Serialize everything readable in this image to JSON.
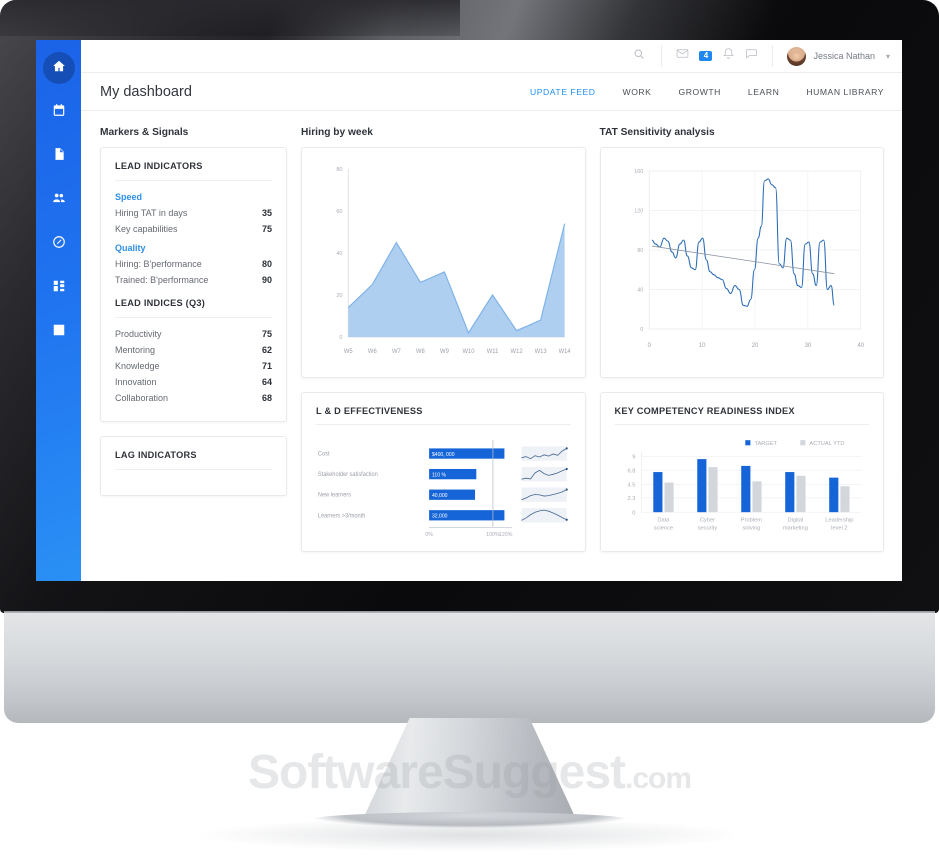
{
  "brand": {
    "watermark": "SoftwareSuggest",
    "watermark_tld": ".com"
  },
  "colors": {
    "accent": "#1e90f5",
    "sidebar_from": "#1b63e8",
    "sidebar_to": "#2a90f5",
    "bar_blue": "#1565d8",
    "bar_grey": "#d3d7dc",
    "area_fill": "#a8cbf0"
  },
  "sidebar": {
    "items": [
      {
        "name": "home",
        "icon": "home-icon",
        "active": true
      },
      {
        "name": "calendar",
        "icon": "calendar-icon",
        "active": false
      },
      {
        "name": "documents",
        "icon": "document-icon",
        "active": false
      },
      {
        "name": "people",
        "icon": "users-icon",
        "active": false
      },
      {
        "name": "links",
        "icon": "link-icon",
        "active": false
      },
      {
        "name": "apps",
        "icon": "grid-icon",
        "active": false
      },
      {
        "name": "reports",
        "icon": "chart-icon",
        "active": false
      }
    ]
  },
  "topbar": {
    "search_icon": "search-icon",
    "mail_icon": "envelope-icon",
    "notification_count": "4",
    "bell_icon": "bell-icon",
    "chat_icon": "chat-icon",
    "user_name": "Jessica Nathan",
    "caret_icon": "chevron-down-icon"
  },
  "header": {
    "title": "My dashboard",
    "tabs": [
      {
        "label": "UPDATE FEED",
        "active": true
      },
      {
        "label": "WORK",
        "active": false
      },
      {
        "label": "GROWTH",
        "active": false
      },
      {
        "label": "LEARN",
        "active": false
      },
      {
        "label": "HUMAN LIBRARY",
        "active": false
      }
    ]
  },
  "sections": {
    "markers": "Markers & Signals",
    "hiring": "Hiring by week",
    "tat": "TAT Sensitivity analysis"
  },
  "lead_indicators": {
    "title": "LEAD INDICATORS",
    "groups": [
      {
        "title": "Speed",
        "rows": [
          {
            "label": "Hiring TAT in days",
            "value": "35"
          },
          {
            "label": "Key capabilities",
            "value": "75"
          }
        ]
      },
      {
        "title": "Quality",
        "rows": [
          {
            "label": "Hiring: B'performance",
            "value": "80"
          },
          {
            "label": "Trained: B'performance",
            "value": "90"
          }
        ]
      }
    ]
  },
  "lead_indices": {
    "title": "LEAD INDICES (Q3)",
    "rows": [
      {
        "label": "Productivity",
        "value": "75"
      },
      {
        "label": "Mentoring",
        "value": "62"
      },
      {
        "label": "Knowledge",
        "value": "71"
      },
      {
        "label": "Innovation",
        "value": "64"
      },
      {
        "label": "Collaboration",
        "value": "68"
      }
    ]
  },
  "lag_indicators": {
    "title": "LAG INDICATORS"
  },
  "ld_effectiveness": {
    "title": "L & D EFFECTIVENESS"
  },
  "competency": {
    "title": "KEY COMPETENCY READINESS INDEX"
  },
  "chart_data": [
    {
      "id": "hiring_by_week",
      "type": "area",
      "title": "Hiring by week",
      "categories": [
        "W5",
        "W6",
        "W7",
        "W8",
        "W9",
        "W10",
        "W11",
        "W12",
        "W13",
        "W14"
      ],
      "values": [
        14,
        25,
        45,
        26,
        31,
        2,
        20,
        3,
        8,
        54
      ],
      "xlabel": "",
      "ylabel": "",
      "ylim": [
        0,
        80
      ],
      "yticks": [
        0,
        20,
        40,
        60,
        80
      ],
      "grid": false,
      "fill_color": "#a8cbf0",
      "line_color": "#7eb2e8"
    },
    {
      "id": "tat_sensitivity",
      "type": "line",
      "title": "TAT Sensitivity analysis",
      "xlim": [
        0,
        40
      ],
      "ylim": [
        0,
        160
      ],
      "xticks": [
        0,
        10,
        20,
        30,
        40
      ],
      "yticks": [
        0,
        40,
        80,
        120,
        160
      ],
      "grid": true,
      "legend": "none",
      "series": [
        {
          "name": "TAT",
          "color": "#2b6cb8",
          "x": [
            0.5,
            1.2,
            2,
            2.8,
            3.5,
            4.3,
            5,
            5.8,
            6.5,
            7.2,
            8,
            8.7,
            9.4,
            10.1,
            10.8,
            11.5,
            12.2,
            13,
            13.8,
            14.6,
            15.4,
            16.2,
            17,
            17.8,
            18.5,
            19.2,
            19.9,
            20.6,
            21.2,
            21.8,
            22.5,
            23.2,
            23.9,
            24.6,
            25.3,
            26,
            26.7,
            27.4,
            28.1,
            28.8,
            29.5,
            30.2,
            30.9,
            31.6,
            32.3,
            33,
            33.7,
            34.4,
            35
          ],
          "y": [
            90,
            86,
            83,
            92,
            89,
            78,
            72,
            86,
            90,
            74,
            62,
            60,
            88,
            92,
            70,
            58,
            55,
            52,
            50,
            41,
            36,
            44,
            40,
            24,
            23,
            30,
            60,
            92,
            104,
            150,
            152,
            146,
            143,
            66,
            62,
            92,
            90,
            56,
            44,
            42,
            86,
            88,
            56,
            44,
            88,
            90,
            40,
            44,
            24
          ]
        },
        {
          "name": "Trend",
          "color": "#8b93a0",
          "x": [
            0.5,
            35
          ],
          "y": [
            84,
            56
          ]
        }
      ]
    },
    {
      "id": "ld_effectiveness",
      "type": "bar",
      "title": "L & D EFFECTIVENESS",
      "orientation": "horizontal",
      "categories": [
        "Cost",
        "Stakeholder satisfaction",
        "New learners",
        "Learners >3/month"
      ],
      "value_labels": [
        "$400, 000",
        "110 %",
        "40,000",
        "32,000"
      ],
      "values": [
        118,
        74,
        72,
        118
      ],
      "xticks": [
        "0%",
        "100%",
        "120%"
      ],
      "xlim": [
        0,
        130
      ],
      "target_line": 100,
      "bar_color": "#1565d8",
      "sparklines": [
        {
          "name": "Cost",
          "points": [
            30,
            36,
            26,
            40,
            34,
            44,
            38,
            48,
            42,
            62,
            74
          ]
        },
        {
          "name": "Stakeholder satisfaction",
          "points": [
            22,
            28,
            24,
            58,
            72,
            54,
            44,
            50,
            58,
            70,
            80
          ]
        },
        {
          "name": "New learners",
          "points": [
            24,
            34,
            46,
            52,
            50,
            44,
            46,
            52,
            58,
            66,
            78
          ]
        },
        {
          "name": "Learners >3/month",
          "points": [
            20,
            34,
            52,
            66,
            74,
            78,
            72,
            62,
            50,
            36,
            24
          ]
        }
      ]
    },
    {
      "id": "key_competency_readiness_index",
      "type": "bar",
      "title": "KEY COMPETENCY READINESS INDEX",
      "categories": [
        "Data science",
        "Cyber security",
        "Problem solving",
        "Digital marketing",
        "Leadership level 2"
      ],
      "ylim": [
        0,
        9
      ],
      "yticks": [
        "0",
        "2.3",
        "4.5",
        "6.8",
        "9"
      ],
      "legend": [
        "TARGET",
        "ACTUAL YTD"
      ],
      "legend_position": "top-right",
      "series": [
        {
          "name": "TARGET",
          "color": "#1565d8",
          "values": [
            6.5,
            8.6,
            7.5,
            6.5,
            5.6
          ]
        },
        {
          "name": "ACTUAL YTD",
          "color": "#d3d7dc",
          "values": [
            4.8,
            7.3,
            5.0,
            5.9,
            4.2
          ]
        }
      ]
    }
  ]
}
